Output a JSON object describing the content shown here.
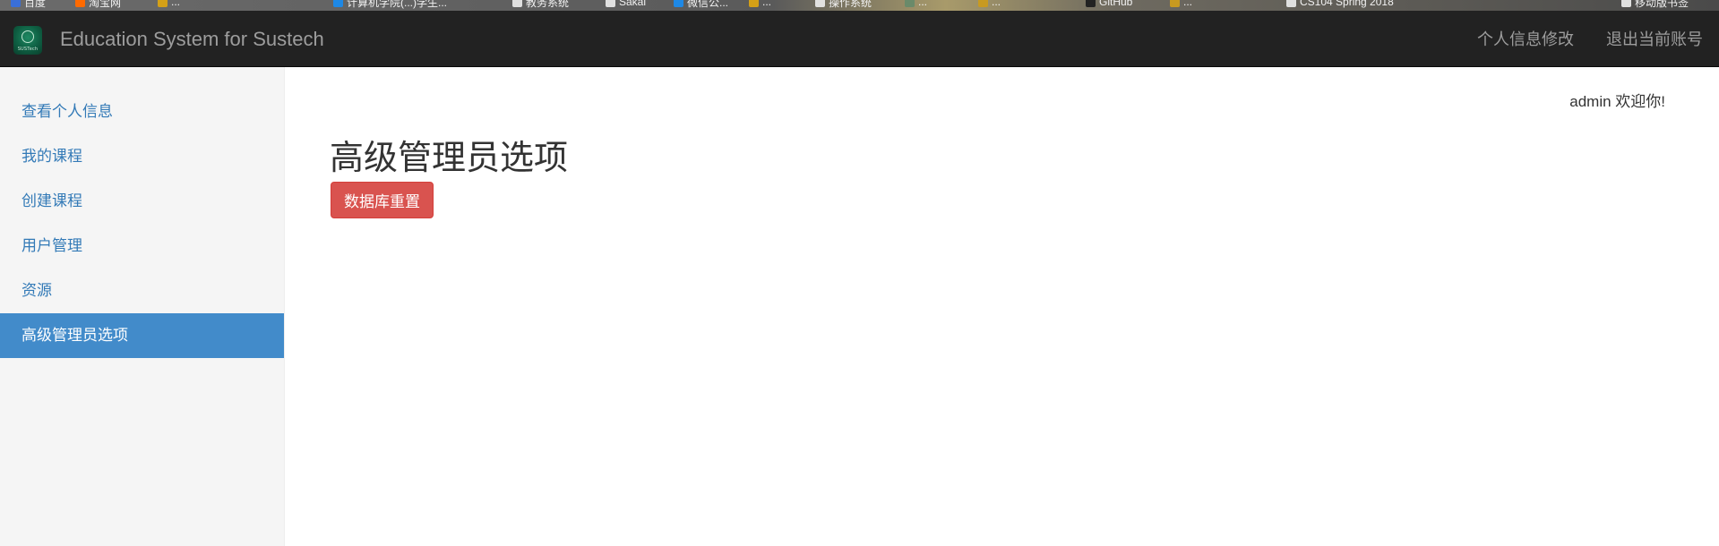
{
  "bookmarks_bar": {
    "items": [
      {
        "label": "百度",
        "color": "#3a6fd8"
      },
      {
        "label": "淘宝网",
        "color": "#ff6a00"
      },
      {
        "label": "...",
        "color": "#d4a017"
      },
      {
        "label": "计算机学院(...)学生...",
        "color": "#1e88e5"
      },
      {
        "label": "教务系统",
        "color": "#e0e0e0"
      },
      {
        "label": "Sakai",
        "color": "#e0e0e0"
      },
      {
        "label": "微信公...",
        "color": "#1e88e5"
      },
      {
        "label": "...",
        "color": "#d4a017"
      },
      {
        "label": "操作系统",
        "color": "#e0e0e0"
      },
      {
        "label": "...",
        "color": "#6a8a6a"
      },
      {
        "label": "...",
        "color": "#c89a20"
      },
      {
        "label": "GitHub",
        "color": "#222222"
      },
      {
        "label": "...",
        "color": "#c89a20"
      },
      {
        "label": "CS104 Spring 2018",
        "color": "#e0e0e0"
      },
      {
        "label": "移动版书签",
        "color": "#e0e0e0"
      }
    ]
  },
  "navbar": {
    "brand": "Education System for Sustech",
    "logo_text": "SUSTech",
    "links": [
      {
        "label": "个人信息修改"
      },
      {
        "label": "退出当前账号"
      }
    ]
  },
  "sidebar": {
    "items": [
      {
        "label": "查看个人信息",
        "active": false
      },
      {
        "label": "我的课程",
        "active": false
      },
      {
        "label": "创建课程",
        "active": false
      },
      {
        "label": "用户管理",
        "active": false
      },
      {
        "label": "资源",
        "active": false
      },
      {
        "label": "高级管理员选项",
        "active": true
      }
    ]
  },
  "main": {
    "welcome": "admin 欢迎你!",
    "title": "高级管理员选项",
    "reset_button": "数据库重置"
  },
  "colors": {
    "navbar_bg": "#222222",
    "sidebar_bg": "#f5f5f5",
    "active_item_bg": "#428bca",
    "link": "#337ab7",
    "danger": "#d9534f"
  }
}
